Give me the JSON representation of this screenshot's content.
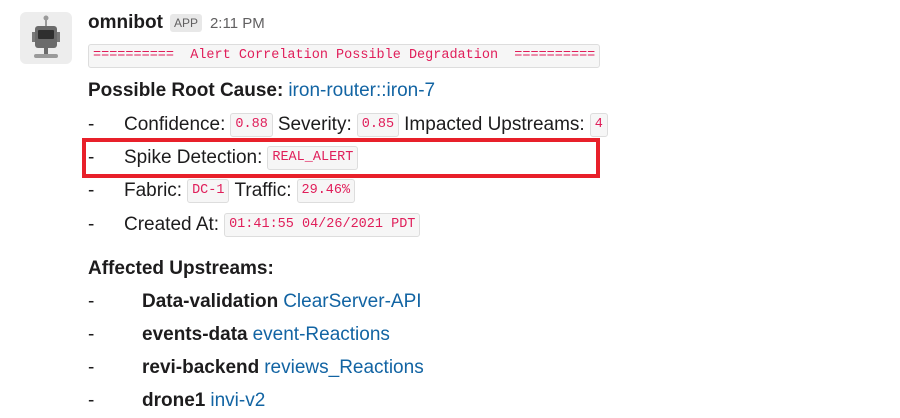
{
  "message": {
    "author": "omnibot",
    "badge": "APP",
    "time": "2:11 PM",
    "title_code": "==========  Alert Correlation Possible Degradation  ==========",
    "root_cause": {
      "label": "Possible Root Cause:",
      "link": "iron-router::iron-7"
    },
    "details": [
      {
        "bullet": "-",
        "parts": [
          {
            "type": "text",
            "value": "Confidence:"
          },
          {
            "type": "code",
            "value": "0.88"
          },
          {
            "type": "text",
            "value": "Severity:"
          },
          {
            "type": "code",
            "value": "0.85"
          },
          {
            "type": "text",
            "value": "Impacted Upstreams:"
          },
          {
            "type": "code",
            "value": "4"
          }
        ]
      },
      {
        "bullet": "-",
        "parts": [
          {
            "type": "text",
            "value": "Spike Detection:"
          },
          {
            "type": "code",
            "value": "REAL_ALERT"
          }
        ]
      },
      {
        "bullet": "-",
        "parts": [
          {
            "type": "text",
            "value": "Fabric:"
          },
          {
            "type": "code",
            "value": "DC-1"
          },
          {
            "type": "text",
            "value": "Traffic:"
          },
          {
            "type": "code",
            "value": "29.46%"
          }
        ]
      },
      {
        "bullet": "-",
        "parts": [
          {
            "type": "text",
            "value": "Created At:"
          },
          {
            "type": "code",
            "value": "01:41:55 04/26/2021 PDT"
          }
        ]
      }
    ],
    "affected_label": "Affected Upstreams:",
    "upstreams": [
      {
        "bullet": "-",
        "name": "Data-validation",
        "link": "ClearServer-API"
      },
      {
        "bullet": "-",
        "name": "events-data",
        "link": "event-Reactions"
      },
      {
        "bullet": "-",
        "name": "revi-backend",
        "link": "reviews_Reactions"
      },
      {
        "bullet": "-",
        "name": "drone1",
        "link": "invi-v2"
      }
    ]
  },
  "colors": {
    "code_text": "#e01e5a",
    "link": "#1264a3",
    "highlight_box": "#e8202a"
  },
  "icons": {
    "avatar": "robot-avatar-icon"
  }
}
